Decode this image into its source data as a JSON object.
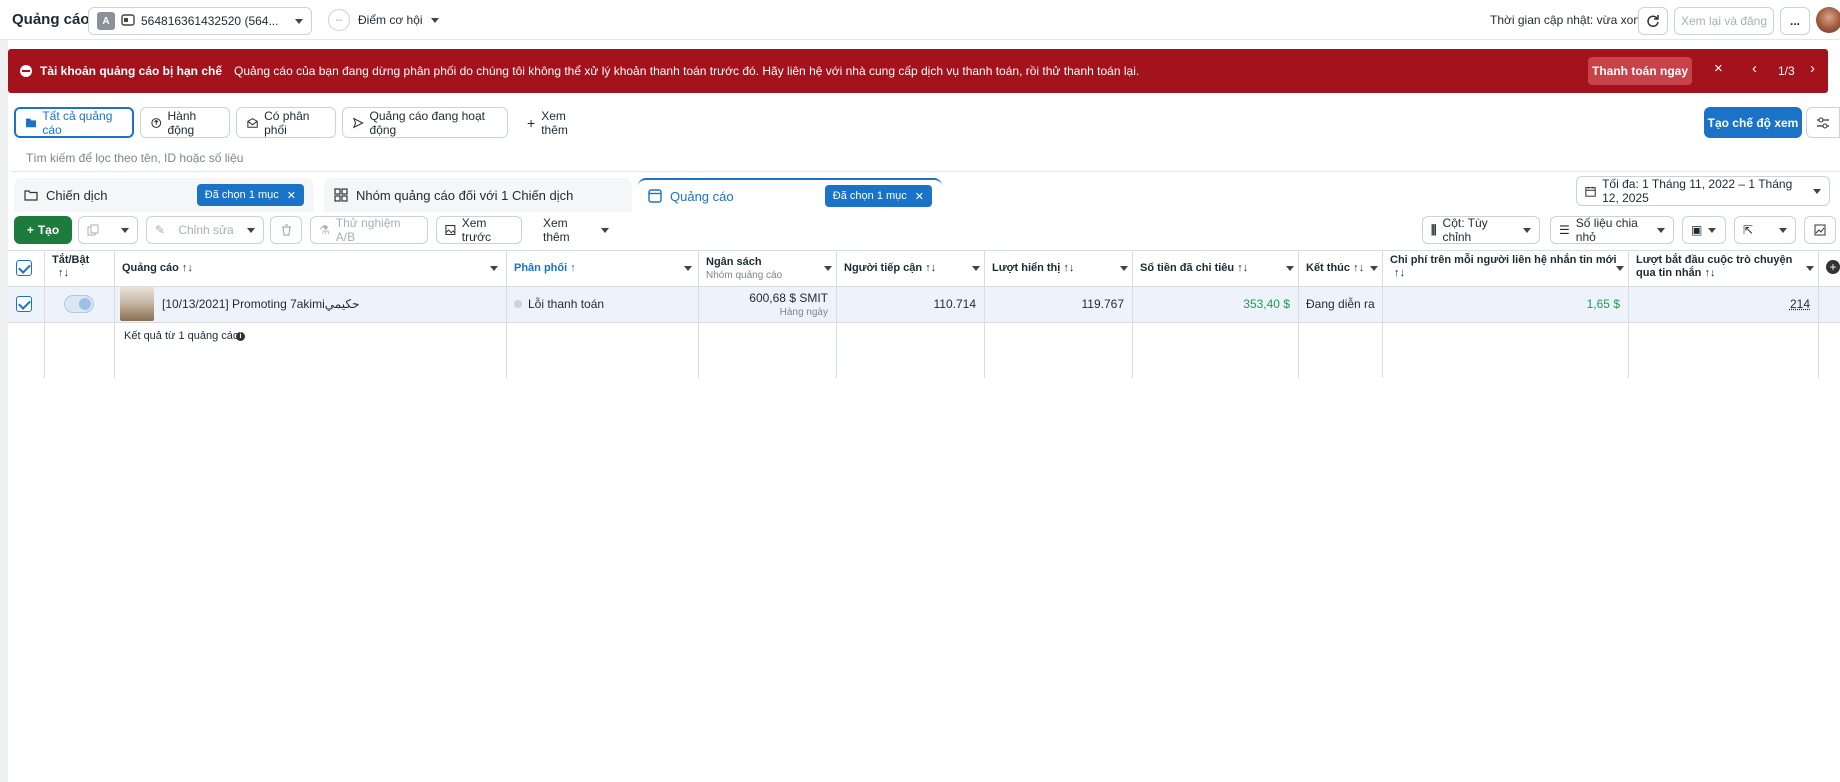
{
  "header": {
    "title": "Quảng cáo",
    "account_avatar": "A",
    "account_id": "564816361432520 (564...",
    "opportunity_label": "Điểm cơ hội",
    "opportunity_icon": "--",
    "update_text": "Thời gian cập nhật: vừa xong",
    "review_publish_label": "Xem lại và đăng",
    "more_label": "..."
  },
  "banner": {
    "title": "Tài khoản quảng cáo bị hạn chế",
    "message": "Quảng cáo của bạn đang dừng phân phối do chúng tôi không thể xử lý khoản thanh toán trước đó. Hãy liên hệ với nhà cung cấp dịch vụ thanh toán, rồi thử thanh toán lại.",
    "pay_label": "Thanh toán ngay",
    "close_icon": "×",
    "pager": "1/3",
    "color": "#a4121b"
  },
  "filter_tabs": {
    "all_ads": "Tất cả quảng cáo",
    "actions": "Hành động",
    "delivering": "Có phân phối",
    "active_ads": "Quảng cáo đang hoạt động",
    "see_more": "Xem thêm",
    "create_view": "Tạo chế độ xem"
  },
  "search": {
    "placeholder": "Tìm kiếm để lọc theo tên, ID hoặc số liệu"
  },
  "levels": {
    "campaigns": "Chiến dịch",
    "campaigns_pill": "Đã chọn 1 mục",
    "adsets": "Nhóm quảng cáo đối với 1 Chiến dịch",
    "ads": "Quảng cáo",
    "ads_pill": "Đã chọn 1 mục"
  },
  "date_range": "Tối đa: 1 Tháng 11, 2022 – 1 Tháng 12, 2025",
  "toolbar": {
    "create": "Tạo",
    "edit": "Chỉnh sửa",
    "ab_test": "Thử nghiệm A/B",
    "preview": "Xem trước",
    "see_more": "Xem thêm",
    "columns": "Cột: Tùy chỉnh",
    "breakdown": "Số liệu chia nhỏ"
  },
  "table": {
    "headers": {
      "toggle": "Tắt/Bật",
      "ad": "Quảng cáo",
      "delivery": "Phân phối",
      "budget": "Ngân sách",
      "budget_sub": "Nhóm quảng cáo",
      "reach": "Người tiếp cận",
      "impressions": "Lượt hiển thị",
      "spent": "Số tiền đã chi tiêu",
      "ends": "Kết thúc",
      "cost_per_contact_1": "Chi phí trên mỗi người liên hệ nhắn tin mới",
      "conversations_1": "Lượt bắt đầu cuộc trò chuyện",
      "conversations_2": "qua tin nhắn"
    },
    "row": {
      "ad_name": "[10/13/2021] Promoting 7akimiحكيمي",
      "delivery": "Lỗi thanh toán",
      "budget": "600,68 $ SMIT",
      "budget_sub": "Hàng ngày",
      "reach": "110.714",
      "impressions": "119.767",
      "spent": "353,40 $",
      "ends": "Đang diễn ra",
      "cost_per_contact": "1,65 $",
      "conversations": "214"
    },
    "summary": "Kết quả từ 1 quảng cáo"
  }
}
